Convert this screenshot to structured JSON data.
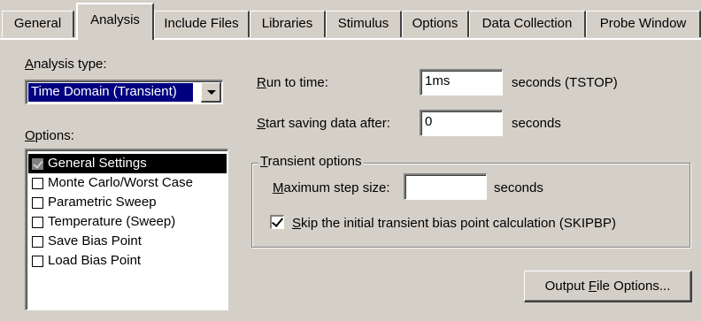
{
  "tabs": [
    {
      "label": "General"
    },
    {
      "label": "Analysis",
      "active": true
    },
    {
      "label": "Include Files"
    },
    {
      "label": "Libraries"
    },
    {
      "label": "Stimulus"
    },
    {
      "label": "Options"
    },
    {
      "label": "Data Collection"
    },
    {
      "label": "Probe Window"
    }
  ],
  "analysis_type": {
    "label_mnemonic": "A",
    "label_rest": "nalysis type:",
    "value": "Time Domain (Transient)"
  },
  "options": {
    "label_mnemonic": "O",
    "label_rest": "ptions:",
    "items": [
      {
        "label": "General Settings",
        "checked": true,
        "selected": true
      },
      {
        "label": "Monte Carlo/Worst Case",
        "checked": false
      },
      {
        "label": "Parametric Sweep",
        "checked": false
      },
      {
        "label": "Temperature (Sweep)",
        "checked": false
      },
      {
        "label": "Save Bias Point",
        "checked": false
      },
      {
        "label": "Load Bias Point",
        "checked": false
      }
    ]
  },
  "run_to_time": {
    "label_mnemonic": "R",
    "label_rest": "un to time:",
    "value": "1ms",
    "unit": "seconds  (TSTOP)"
  },
  "start_saving": {
    "label_mnemonic": "S",
    "label_rest": "tart saving data after:",
    "value": "0",
    "unit": "seconds"
  },
  "transient_options": {
    "title_mnemonic": "T",
    "title_rest": "ransient options",
    "max_step": {
      "label_mnemonic": "M",
      "label_rest": "aximum step size:",
      "value": "",
      "unit": "seconds"
    },
    "skip_bias": {
      "checked": true,
      "label_mnemonic": "S",
      "label_rest": "kip the initial transient bias point calculation  (SKIPBP)"
    }
  },
  "output_button": {
    "label_before": "Output ",
    "label_mnemonic": "F",
    "label_after": "ile Options..."
  },
  "colors": {
    "dialog_bg": "#d4d0c8",
    "selection_bg": "#000080",
    "list_selection_bg": "#000000"
  }
}
